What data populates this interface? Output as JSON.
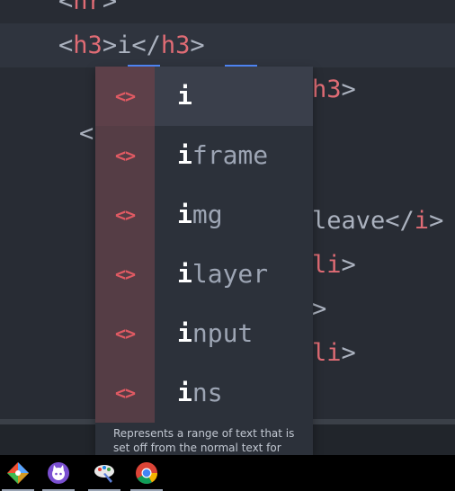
{
  "editor": {
    "lines": [
      {
        "open_lt": "<",
        "tag": "hr",
        "close_gt": ">"
      },
      {
        "lt1": "<",
        "tag1": "h3",
        "gt1": ">",
        "text": "i",
        "lt2": "</",
        "tag2": "h3",
        "gt2": ">"
      },
      {
        "tag": "h3",
        "gt": ">"
      },
      {
        "lt": "<"
      },
      {
        "text": "leave",
        "lt": "</",
        "tag": "i",
        "gt": ">"
      },
      {
        "tag": "li",
        "gt": ">"
      },
      {
        "gt": ">"
      },
      {
        "tag": "li",
        "gt": ">"
      }
    ]
  },
  "autocomplete": {
    "icon_glyph": "<>",
    "items": [
      {
        "match": "i",
        "rest": ""
      },
      {
        "match": "i",
        "rest": "frame"
      },
      {
        "match": "i",
        "rest": "mg"
      },
      {
        "match": "i",
        "rest": "layer"
      },
      {
        "match": "i",
        "rest": "nput"
      },
      {
        "match": "i",
        "rest": "ns"
      }
    ],
    "description": "Represents a range of text that is set off from the normal text for"
  },
  "taskbar": {
    "apps": [
      {
        "icon": "git-icon"
      },
      {
        "icon": "github-desktop-icon"
      },
      {
        "icon": "paint-tool-icon"
      },
      {
        "icon": "chrome-icon"
      }
    ]
  },
  "colors": {
    "editor_bg": "#282c34",
    "tag": "#e06c75",
    "popup_bg": "#2c313a",
    "popup_icon_column": "#553d45",
    "taskbar_bg": "#000000"
  }
}
